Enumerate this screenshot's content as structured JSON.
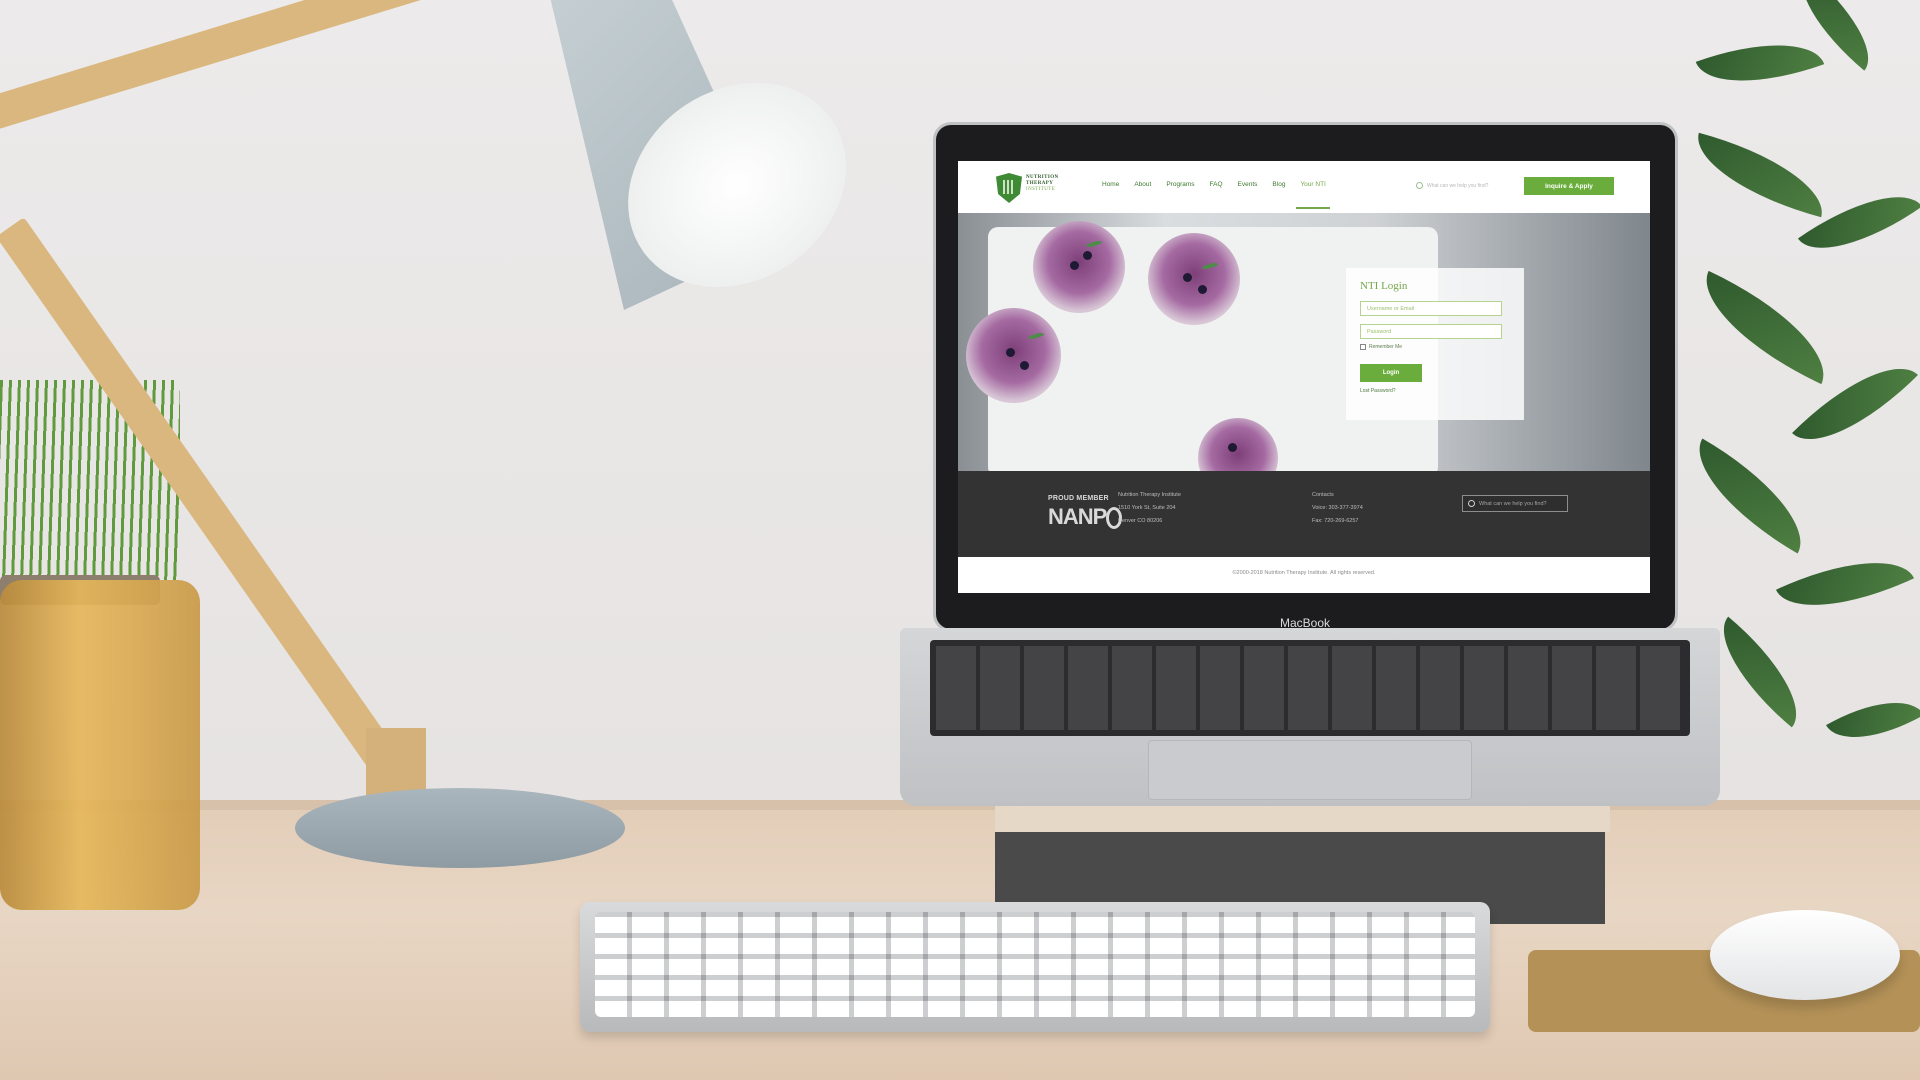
{
  "device": {
    "brand": "MacBook"
  },
  "site": {
    "logo_lines": [
      "NUTRITION",
      "THERAPY",
      "INSTITUTE"
    ],
    "nav": [
      "Home",
      "About",
      "Programs",
      "FAQ",
      "Events",
      "Blog",
      "Your NTI"
    ],
    "active_nav": "Your NTI",
    "search_placeholder": "What can we help you find?",
    "cta_label": "Inquire & Apply",
    "accent_color": "#6aad3c"
  },
  "login": {
    "title": "NTI Login",
    "username_placeholder": "Username or Email",
    "password_placeholder": "Password",
    "remember_label": "Remember Me",
    "button_label": "Login",
    "lost_password": "Lost Password?"
  },
  "footer": {
    "proud_member": "PROUD MEMBER",
    "nanp": "NANP",
    "address_lines": [
      "Nutrition Therapy Institute",
      "1510 York St, Suite 204",
      "Denver CO 80206"
    ],
    "contacts_lines": [
      "Contacts",
      "Voice: 303-377-3974",
      "Fax: 720-269-6257"
    ],
    "search_placeholder": "What can we help you find?",
    "copyright": "©2000-2018 Nutrition Therapy Institute. All rights reserved."
  }
}
